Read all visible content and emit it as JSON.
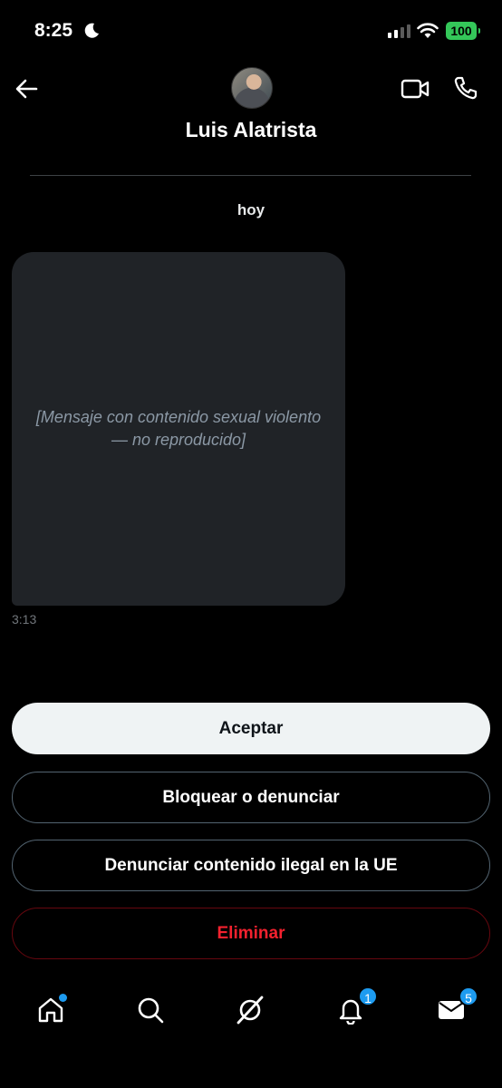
{
  "status_bar": {
    "time": "8:25",
    "battery": "100",
    "icons": [
      "moon-icon",
      "signal-icon",
      "wifi-icon",
      "battery-icon"
    ]
  },
  "header": {
    "contact_name": "Luis Alatrista",
    "icons": [
      "back-arrow-icon",
      "video-call-icon",
      "phone-icon"
    ]
  },
  "conversation": {
    "day_label": "hoy",
    "messages": [
      {
        "time": "3:13",
        "placeholder": "[Mensaje con contenido sexual violento — no reproducido]"
      }
    ]
  },
  "actions": {
    "accept_label": "Aceptar",
    "block_label": "Bloquear o denunciar",
    "report_eu_label": "Denunciar contenido ilegal en la UE",
    "delete_label": "Eliminar"
  },
  "tabbar": {
    "notifications_count": "1",
    "messages_count": "5",
    "icons": [
      "home-icon",
      "search-icon",
      "grok-icon",
      "bell-icon",
      "mail-icon"
    ]
  },
  "colors": {
    "accent": "#1d9bf0",
    "danger": "#f4212e",
    "battery": "#34c759"
  }
}
